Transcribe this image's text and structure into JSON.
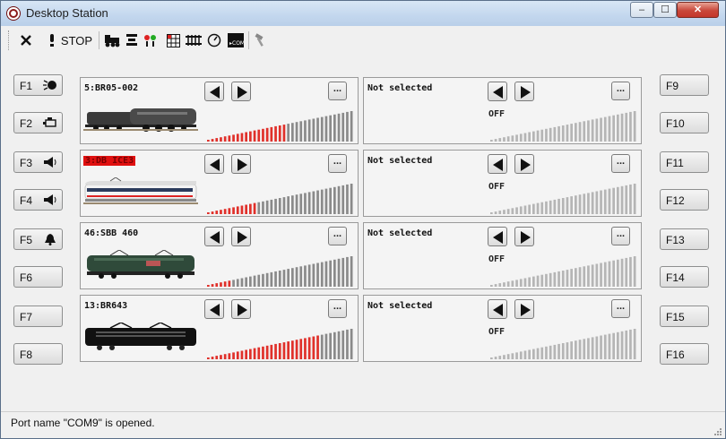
{
  "window": {
    "title": "Desktop Station",
    "controls": {
      "minimize": "–",
      "maximize": "☐",
      "close": "✕"
    }
  },
  "toolbar": {
    "items": [
      {
        "name": "close-icon"
      },
      {
        "name": "stop-icon",
        "label": "STOP"
      },
      {
        "name": "locomotive-icon"
      },
      {
        "name": "accessory-icon"
      },
      {
        "name": "signal-icon"
      },
      {
        "name": "layout-grid-icon"
      },
      {
        "name": "track-icon"
      },
      {
        "name": "meter-icon"
      },
      {
        "name": "com-icon"
      },
      {
        "name": "settings-hammer-icon"
      }
    ]
  },
  "functions_left": [
    {
      "label": "F1",
      "icon": "headlight-icon"
    },
    {
      "label": "F2",
      "icon": "engine-icon"
    },
    {
      "label": "F3",
      "icon": "horn-icon"
    },
    {
      "label": "F4",
      "icon": "horn-icon"
    },
    {
      "label": "F5",
      "icon": "bell-icon"
    },
    {
      "label": "F6",
      "icon": ""
    },
    {
      "label": "F7",
      "icon": ""
    },
    {
      "label": "F8",
      "icon": ""
    }
  ],
  "functions_right": [
    {
      "label": "F9"
    },
    {
      "label": "F10"
    },
    {
      "label": "F11"
    },
    {
      "label": "F12"
    },
    {
      "label": "F13"
    },
    {
      "label": "F14"
    },
    {
      "label": "F15"
    },
    {
      "label": "F16"
    }
  ],
  "panels": [
    {
      "name": "5:BR05-002",
      "selected": true,
      "highlight": false,
      "speed_steps": 19,
      "loco": "br05"
    },
    {
      "name": "Not selected",
      "selected": false,
      "status": "OFF",
      "speed_steps": 0
    },
    {
      "name": "3:DB ICE3",
      "selected": true,
      "highlight": true,
      "speed_steps": 12,
      "loco": "ice3"
    },
    {
      "name": "Not selected",
      "selected": false,
      "status": "OFF",
      "speed_steps": 0
    },
    {
      "name": "46:SBB 460",
      "selected": true,
      "highlight": false,
      "speed_steps": 6,
      "loco": "sbb460"
    },
    {
      "name": "Not selected",
      "selected": false,
      "status": "OFF",
      "speed_steps": 0
    },
    {
      "name": "13:BR643",
      "selected": true,
      "highlight": false,
      "speed_steps": 27,
      "loco": "br643"
    },
    {
      "name": "Not selected",
      "selected": false,
      "status": "OFF",
      "speed_steps": 0
    }
  ],
  "panel_buttons": {
    "more": "..."
  },
  "speed_total_steps": 35,
  "colors": {
    "speed_active": "#e0302a",
    "speed_inactive_sel": "#8a8a8a",
    "speed_inactive_off": "#b5b5b5"
  },
  "status": {
    "text": "Port name \"COM9\" is opened."
  }
}
